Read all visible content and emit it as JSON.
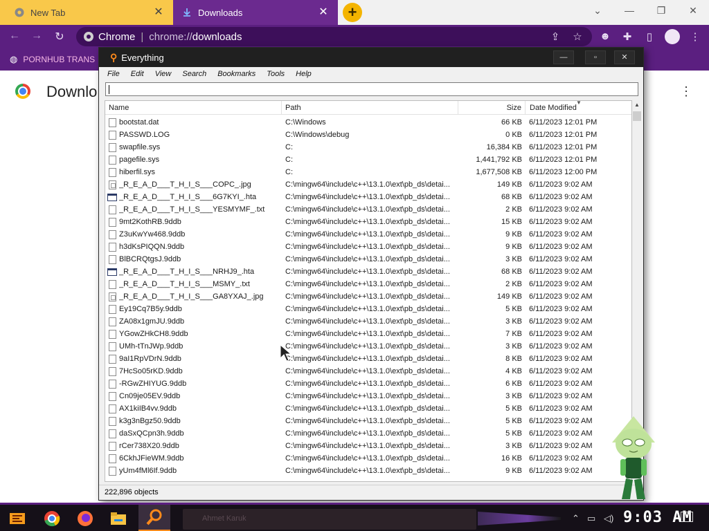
{
  "browser": {
    "tabs": [
      {
        "title": "New Tab",
        "active": false
      },
      {
        "title": "Downloads",
        "active": true
      }
    ],
    "new_tab_symbol": "+",
    "omnibox": {
      "site_label": "Chrome",
      "url_scheme": "chrome://",
      "url_path": "downloads"
    },
    "bookmark": {
      "label": "PORNHUB TRANS"
    }
  },
  "downloads_page": {
    "title": "Downlo"
  },
  "everything": {
    "title": "Everything",
    "menu": [
      "File",
      "Edit",
      "View",
      "Search",
      "Bookmarks",
      "Tools",
      "Help"
    ],
    "search_value": "",
    "columns": {
      "name": "Name",
      "path": "Path",
      "size": "Size",
      "date": "Date Modified"
    },
    "rows": [
      {
        "name": "bootstat.dat",
        "path": "C:\\Windows",
        "size": "66 KB",
        "date": "6/11/2023 12:01 PM",
        "icon": "file"
      },
      {
        "name": "PASSWD.LOG",
        "path": "C:\\Windows\\debug",
        "size": "0 KB",
        "date": "6/11/2023 12:01 PM",
        "icon": "file"
      },
      {
        "name": "swapfile.sys",
        "path": "C:",
        "size": "16,384 KB",
        "date": "6/11/2023 12:01 PM",
        "icon": "file"
      },
      {
        "name": "pagefile.sys",
        "path": "C:",
        "size": "1,441,792 KB",
        "date": "6/11/2023 12:01 PM",
        "icon": "file"
      },
      {
        "name": "hiberfil.sys",
        "path": "C:",
        "size": "1,677,508 KB",
        "date": "6/11/2023 12:00 PM",
        "icon": "file"
      },
      {
        "name": "_R_E_A_D___T_H_I_S___COPC_.jpg",
        "path": "C:\\mingw64\\include\\c++\\13.1.0\\ext\\pb_ds\\detai...",
        "size": "149 KB",
        "date": "6/11/2023 9:02 AM",
        "icon": "img"
      },
      {
        "name": "_R_E_A_D___T_H_I_S___6G7KYI_.hta",
        "path": "C:\\mingw64\\include\\c++\\13.1.0\\ext\\pb_ds\\detai...",
        "size": "68 KB",
        "date": "6/11/2023 9:02 AM",
        "icon": "hta"
      },
      {
        "name": "_R_E_A_D___T_H_I_S___YESMYMF_.txt",
        "path": "C:\\mingw64\\include\\c++\\13.1.0\\ext\\pb_ds\\detai...",
        "size": "2 KB",
        "date": "6/11/2023 9:02 AM",
        "icon": "file"
      },
      {
        "name": "9mt2KothRB.9ddb",
        "path": "C:\\mingw64\\include\\c++\\13.1.0\\ext\\pb_ds\\detai...",
        "size": "15 KB",
        "date": "6/11/2023 9:02 AM",
        "icon": "file"
      },
      {
        "name": "Z3uKwYw468.9ddb",
        "path": "C:\\mingw64\\include\\c++\\13.1.0\\ext\\pb_ds\\detai...",
        "size": "9 KB",
        "date": "6/11/2023 9:02 AM",
        "icon": "file"
      },
      {
        "name": "h3dKsPIQQN.9ddb",
        "path": "C:\\mingw64\\include\\c++\\13.1.0\\ext\\pb_ds\\detai...",
        "size": "9 KB",
        "date": "6/11/2023 9:02 AM",
        "icon": "file"
      },
      {
        "name": "BlBCRQtgsJ.9ddb",
        "path": "C:\\mingw64\\include\\c++\\13.1.0\\ext\\pb_ds\\detai...",
        "size": "3 KB",
        "date": "6/11/2023 9:02 AM",
        "icon": "file"
      },
      {
        "name": "_R_E_A_D___T_H_I_S___NRHJ9_.hta",
        "path": "C:\\mingw64\\include\\c++\\13.1.0\\ext\\pb_ds\\detai...",
        "size": "68 KB",
        "date": "6/11/2023 9:02 AM",
        "icon": "hta"
      },
      {
        "name": "_R_E_A_D___T_H_I_S___MSMY_.txt",
        "path": "C:\\mingw64\\include\\c++\\13.1.0\\ext\\pb_ds\\detai...",
        "size": "2 KB",
        "date": "6/11/2023 9:02 AM",
        "icon": "file"
      },
      {
        "name": "_R_E_A_D___T_H_I_S___GA8YXAJ_.jpg",
        "path": "C:\\mingw64\\include\\c++\\13.1.0\\ext\\pb_ds\\detai...",
        "size": "149 KB",
        "date": "6/11/2023 9:02 AM",
        "icon": "img"
      },
      {
        "name": "Ey19Cq7B5y.9ddb",
        "path": "C:\\mingw64\\include\\c++\\13.1.0\\ext\\pb_ds\\detai...",
        "size": "5 KB",
        "date": "6/11/2023 9:02 AM",
        "icon": "file"
      },
      {
        "name": "ZA08x1gmJU.9ddb",
        "path": "C:\\mingw64\\include\\c++\\13.1.0\\ext\\pb_ds\\detai...",
        "size": "3 KB",
        "date": "6/11/2023 9:02 AM",
        "icon": "file"
      },
      {
        "name": "YGowZHkCH8.9ddb",
        "path": "C:\\mingw64\\include\\c++\\13.1.0\\ext\\pb_ds\\detai...",
        "size": "7 KB",
        "date": "6/11/2023 9:02 AM",
        "icon": "file"
      },
      {
        "name": "UMh-tTnJWp.9ddb",
        "path": "C:\\mingw64\\include\\c++\\13.1.0\\ext\\pb_ds\\detai...",
        "size": "3 KB",
        "date": "6/11/2023 9:02 AM",
        "icon": "file"
      },
      {
        "name": "9aI1RpVDrN.9ddb",
        "path": "C:\\mingw64\\include\\c++\\13.1.0\\ext\\pb_ds\\detai...",
        "size": "8 KB",
        "date": "6/11/2023 9:02 AM",
        "icon": "file"
      },
      {
        "name": "7HcSo05rKD.9ddb",
        "path": "C:\\mingw64\\include\\c++\\13.1.0\\ext\\pb_ds\\detai...",
        "size": "4 KB",
        "date": "6/11/2023 9:02 AM",
        "icon": "file"
      },
      {
        "name": "-RGwZHIYUG.9ddb",
        "path": "C:\\mingw64\\include\\c++\\13.1.0\\ext\\pb_ds\\detai...",
        "size": "6 KB",
        "date": "6/11/2023 9:02 AM",
        "icon": "file"
      },
      {
        "name": "Cn09je05EV.9ddb",
        "path": "C:\\mingw64\\include\\c++\\13.1.0\\ext\\pb_ds\\detai...",
        "size": "3 KB",
        "date": "6/11/2023 9:02 AM",
        "icon": "file"
      },
      {
        "name": "AX1kiIB4vv.9ddb",
        "path": "C:\\mingw64\\include\\c++\\13.1.0\\ext\\pb_ds\\detai...",
        "size": "5 KB",
        "date": "6/11/2023 9:02 AM",
        "icon": "file"
      },
      {
        "name": "k3g3nBgz50.9ddb",
        "path": "C:\\mingw64\\include\\c++\\13.1.0\\ext\\pb_ds\\detai...",
        "size": "5 KB",
        "date": "6/11/2023 9:02 AM",
        "icon": "file"
      },
      {
        "name": "daSxQCpn3h.9ddb",
        "path": "C:\\mingw64\\include\\c++\\13.1.0\\ext\\pb_ds\\detai...",
        "size": "5 KB",
        "date": "6/11/2023 9:02 AM",
        "icon": "file"
      },
      {
        "name": "rCer738X20.9ddb",
        "path": "C:\\mingw64\\include\\c++\\13.1.0\\ext\\pb_ds\\detai...",
        "size": "3 KB",
        "date": "6/11/2023 9:02 AM",
        "icon": "file"
      },
      {
        "name": "6CkhJFieWM.9ddb",
        "path": "C:\\mingw64\\include\\c++\\13.1.0\\ext\\pb_ds\\detai...",
        "size": "16 KB",
        "date": "6/11/2023 9:02 AM",
        "icon": "file"
      },
      {
        "name": "yUm4fMl6If.9ddb",
        "path": "C:\\mingw64\\include\\c++\\13.1.0\\ext\\pb_ds\\detai...",
        "size": "9 KB",
        "date": "6/11/2023 9:02 AM",
        "icon": "file"
      }
    ],
    "status": "222,896 objects"
  },
  "taskbar": {
    "apps": [
      "start-menu",
      "chrome",
      "firefox",
      "file-explorer",
      "everything"
    ],
    "preview_text": "Ahmet Karuk",
    "clock": "9:03 AM"
  },
  "colors": {
    "browser_theme": "#5b1f80",
    "active_tab": "#6b2a8f",
    "inactive_tab": "#f9c84a",
    "everything_accent": "#ff8a1a"
  }
}
